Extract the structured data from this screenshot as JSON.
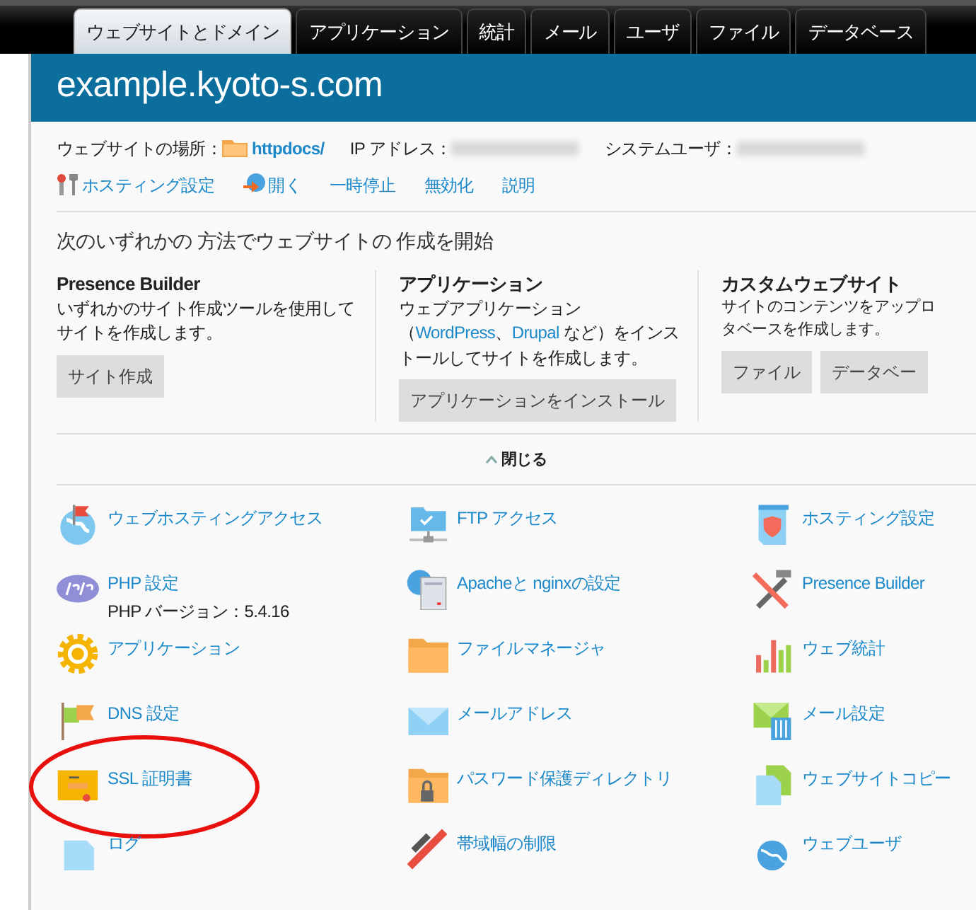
{
  "tabs": [
    {
      "label": "ウェブサイトとドメイン",
      "selected": true
    },
    {
      "label": "アプリケーション",
      "selected": false
    },
    {
      "label": "統計",
      "selected": false
    },
    {
      "label": "メール",
      "selected": false
    },
    {
      "label": "ユーザ",
      "selected": false
    },
    {
      "label": "ファイル",
      "selected": false
    },
    {
      "label": "データベース",
      "selected": false
    }
  ],
  "domain": {
    "title": "example.kyoto-s.com",
    "info": [
      {
        "label": "ウェブサイトの場所：",
        "value": "httpdocs/",
        "kind": "folder"
      },
      {
        "label": "IP アドレス：",
        "kind": "redacted"
      },
      {
        "label": "システムユーザ：",
        "kind": "redacted"
      }
    ],
    "actions": [
      {
        "label": "ホスティング設定",
        "kind": "tools"
      },
      {
        "label": "開く",
        "kind": "open"
      },
      {
        "label": "一時停止",
        "kind": "plain"
      },
      {
        "label": "無効化",
        "kind": "plain"
      },
      {
        "label": "説明",
        "kind": "plain"
      }
    ]
  },
  "create": {
    "heading": "次のいずれかの 方法でウェブサイトの 作成を開始",
    "columns": [
      {
        "title": "Presence Builder",
        "description": [
          {
            "text": "いずれかのサイト作成ツールを使用してサイトを作成します。",
            "link": false
          }
        ],
        "buttons": [
          "サイト作成"
        ]
      },
      {
        "title": "アプリケーション",
        "description": [
          {
            "text": "ウェブアプリケーション（",
            "link": false
          },
          {
            "text": "WordPress",
            "link": true
          },
          {
            "text": "、",
            "link": false
          },
          {
            "text": "Drupal",
            "link": true
          },
          {
            "text": " など）をインストールしてサイトを作成します。",
            "link": false
          }
        ],
        "buttons": [
          "アプリケーションをインストール"
        ]
      },
      {
        "title": "カスタムウェブサイト",
        "description": [
          {
            "text": "サイトのコンテンツをアップロタベースを作成します。",
            "link": false
          }
        ],
        "buttons": [
          "ファイル",
          "データベー"
        ]
      }
    ],
    "collapse": {
      "label": "閉じる",
      "expanded": true
    }
  },
  "tools": [
    {
      "label": "ウェブホスティングアクセス",
      "highlighted": false
    },
    {
      "label": "FTP アクセス",
      "highlighted": false
    },
    {
      "label": "ホスティング設定",
      "highlighted": false
    },
    {
      "label": "PHP 設定",
      "note": "PHP バージョン：5.4.16",
      "highlighted": false
    },
    {
      "label": "Apacheと nginxの設定",
      "highlighted": false
    },
    {
      "label": "Presence Builder",
      "highlighted": false
    },
    {
      "label": "アプリケーション",
      "highlighted": false
    },
    {
      "label": "ファイルマネージャ",
      "highlighted": false
    },
    {
      "label": "ウェブ統計",
      "highlighted": false
    },
    {
      "label": "DNS 設定",
      "highlighted": false
    },
    {
      "label": "メールアドレス",
      "highlighted": false
    },
    {
      "label": "メール設定",
      "highlighted": false
    },
    {
      "label": "SSL 証明書",
      "highlighted": true
    },
    {
      "label": "パスワード保護ディレクトリ",
      "highlighted": false
    },
    {
      "label": "ウェブサイトコピー",
      "highlighted": false
    },
    {
      "label": "ログ",
      "highlighted": false
    },
    {
      "label": "帯域幅の制限",
      "highlighted": false
    },
    {
      "label": "ウェブユーザ",
      "highlighted": false
    }
  ]
}
